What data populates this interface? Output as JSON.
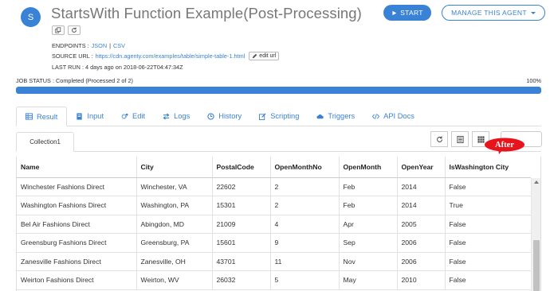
{
  "header": {
    "avatar_letter": "S",
    "title": "StartsWith Function Example(Post-Processing)",
    "start_label": "START",
    "manage_label": "MANAGE THIS AGENT"
  },
  "meta": {
    "endpoints_label": "ENDPOINTS :",
    "endpoint_json": "JSON",
    "endpoint_sep": "|",
    "endpoint_csv": "CSV",
    "source_url_label": "SOURCE URL :",
    "source_url": "https://cdn.agenty.com/examples/table/simple-table-1.html",
    "edit_url_label": "edit url",
    "last_run": "LAST RUN : 4 days ago on 2018-06-22T04:47:34Z"
  },
  "job": {
    "status": "JOB STATUS : Completed (Processed 2 of 2)",
    "percent_label": "100%",
    "progress": 1.0
  },
  "tabs": [
    {
      "label": "Result",
      "icon": "table-icon"
    },
    {
      "label": "Input",
      "icon": "book-icon"
    },
    {
      "label": "Edit",
      "icon": "cogs-icon"
    },
    {
      "label": "Logs",
      "icon": "exchange-icon"
    },
    {
      "label": "History",
      "icon": "clock-icon"
    },
    {
      "label": "Scripting",
      "icon": "pencil-icon"
    },
    {
      "label": "Triggers",
      "icon": "cloud-icon"
    },
    {
      "label": "API Docs",
      "icon": "code-icon"
    }
  ],
  "collection_tab": "Collection1",
  "callout_label": "After",
  "table": {
    "headers": [
      "Name",
      "City",
      "PostalCode",
      "OpenMonthNo",
      "OpenMonth",
      "OpenYear",
      "IsWashington City"
    ],
    "rows": [
      [
        "Winchester Fashions Direct",
        "Winchester, VA",
        "22602",
        "2",
        "Feb",
        "2014",
        "False"
      ],
      [
        "Washington Fashions Direct",
        "Washington, PA",
        "15301",
        "2",
        "Feb",
        "2014",
        "True"
      ],
      [
        "Bel Air Fashions Direct",
        "Abingdon, MD",
        "21009",
        "4",
        "Apr",
        "2005",
        "False"
      ],
      [
        "Greensburg Fashions Direct",
        "Greensburg, PA",
        "15601",
        "9",
        "Sep",
        "2006",
        "False"
      ],
      [
        "Zanesville Fashions Direct",
        "Zanesville, OH",
        "43701",
        "11",
        "Nov",
        "2006",
        "False"
      ],
      [
        "Weirton Fashions Direct",
        "Weirton, WV",
        "26032",
        "5",
        "May",
        "2010",
        "False"
      ]
    ]
  },
  "colors": {
    "accent": "#3a82d6",
    "callout": "#e8141c"
  }
}
